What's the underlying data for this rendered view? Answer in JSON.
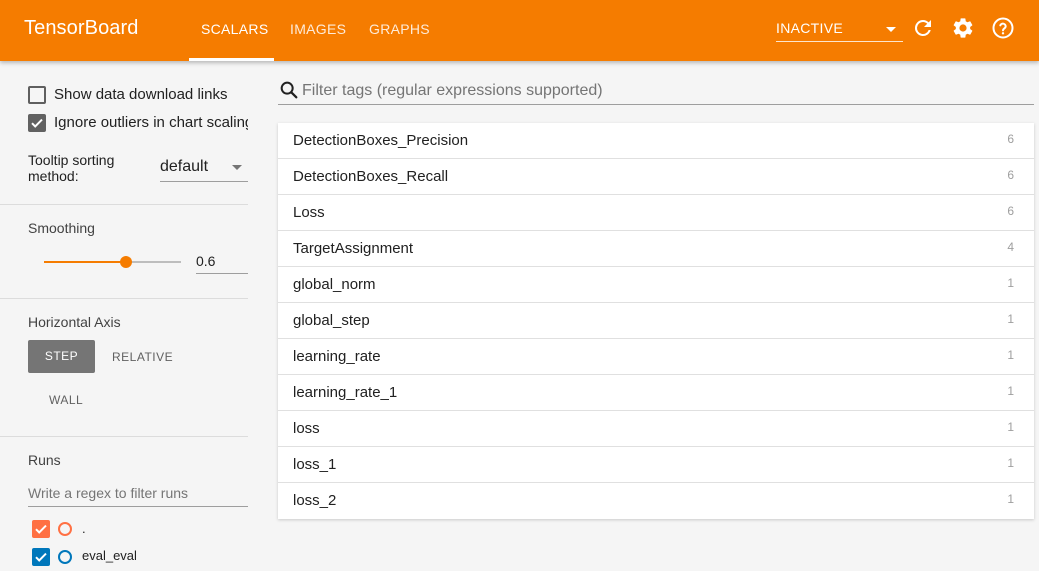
{
  "header": {
    "brand": "TensorBoard",
    "tabs": [
      {
        "label": "SCALARS",
        "active": true
      },
      {
        "label": "IMAGES",
        "active": false
      },
      {
        "label": "GRAPHS",
        "active": false
      }
    ],
    "status_select": "INACTIVE",
    "icons": [
      "refresh-icon",
      "settings-icon",
      "help-icon"
    ],
    "accent_color": "#f57c00"
  },
  "sidebar": {
    "options": {
      "download_links": {
        "label": "Show data download links",
        "checked": false
      },
      "ignore_outliers": {
        "label": "Ignore outliers in chart scaling",
        "checked": true
      },
      "tooltip_label_1": "Tooltip sorting",
      "tooltip_label_2": "method:",
      "tooltip_value": "default"
    },
    "smoothing": {
      "title": "Smoothing",
      "value": "0.6",
      "fraction": 0.6
    },
    "horizontal_axis": {
      "title": "Horizontal Axis",
      "step": "STEP",
      "relative": "RELATIVE",
      "wall": "WALL",
      "selected": "STEP"
    },
    "runs": {
      "title": "Runs",
      "filter_placeholder": "Write a regex to filter runs",
      "items": [
        {
          "name": ".",
          "checked": true,
          "color": "#ff7043"
        },
        {
          "name": "eval_eval",
          "checked": true,
          "color": "#0077bb"
        }
      ]
    }
  },
  "main": {
    "filter_placeholder": "Filter tags (regular expressions supported)",
    "tags": [
      {
        "name": "DetectionBoxes_Precision",
        "count": "6"
      },
      {
        "name": "DetectionBoxes_Recall",
        "count": "6"
      },
      {
        "name": "Loss",
        "count": "6"
      },
      {
        "name": "TargetAssignment",
        "count": "4"
      },
      {
        "name": "global_norm",
        "count": "1"
      },
      {
        "name": "global_step",
        "count": "1"
      },
      {
        "name": "learning_rate",
        "count": "1"
      },
      {
        "name": "learning_rate_1",
        "count": "1"
      },
      {
        "name": "loss",
        "count": "1"
      },
      {
        "name": "loss_1",
        "count": "1"
      },
      {
        "name": "loss_2",
        "count": "1"
      }
    ]
  }
}
